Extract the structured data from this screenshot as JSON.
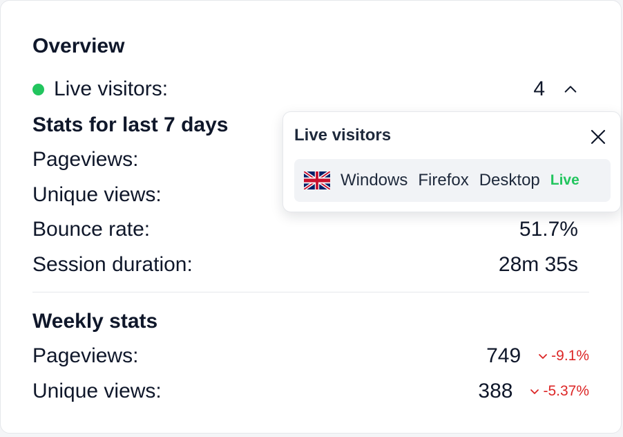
{
  "overview": {
    "title": "Overview",
    "live_visitors_label": "Live visitors:",
    "live_visitors_value": "4"
  },
  "stats_7d": {
    "heading": "Stats for last 7 days",
    "pageviews_label": "Pageviews:",
    "unique_label": "Unique views:",
    "bounce_label": "Bounce rate:",
    "bounce_value": "51.7%",
    "session_label": "Session duration:",
    "session_value": "28m 35s"
  },
  "weekly": {
    "heading": "Weekly stats",
    "pageviews_label": "Pageviews:",
    "pageviews_value": "749",
    "pageviews_change": "-9.1%",
    "unique_label": "Unique views:",
    "unique_value": "388",
    "unique_change": "-5.37%"
  },
  "live_popover": {
    "title": "Live visitors",
    "visitors": [
      {
        "flag_icon": "uk-flag-icon",
        "os": "Windows",
        "browser": "Firefox",
        "device": "Desktop",
        "status": "Live"
      }
    ]
  },
  "colors": {
    "live_green": "#22c55e",
    "negative_red": "#dc2626",
    "text": "#0f172a"
  }
}
